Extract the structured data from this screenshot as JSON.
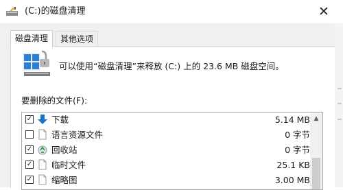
{
  "window": {
    "title": "(C:)的磁盘清理",
    "close_glyph": "✕",
    "title_icon": "disk-cleanup-icon"
  },
  "tabs": [
    {
      "label": "磁盘清理",
      "active": true
    },
    {
      "label": "其他选项",
      "active": false
    }
  ],
  "info": {
    "icon": "disk-cleanup-large-icon",
    "text": "可以使用“磁盘清理”来释放  (C:) 上的 23.6 MB 磁盘空间。"
  },
  "files_section": {
    "label": "要删除的文件(F):",
    "items": [
      {
        "name": "下载",
        "size": "5.14 MB",
        "checked": true,
        "icon": "download-arrow-icon"
      },
      {
        "name": "语言资源文件",
        "size": "0 字节",
        "checked": false,
        "icon": "file-icon"
      },
      {
        "name": "回收站",
        "size": "0 字节",
        "checked": true,
        "icon": "recycle-bin-icon"
      },
      {
        "name": "临时文件",
        "size": "25.1 KB",
        "checked": true,
        "icon": "file-icon"
      },
      {
        "name": "缩略图",
        "size": "3.00 MB",
        "checked": true,
        "icon": "file-icon"
      }
    ],
    "check_glyph": "✓",
    "scroll_up_glyph": "▲"
  },
  "colors": {
    "accent": "#1a73c9",
    "panel": "#f0f0f0",
    "border": "#a8a8a8"
  }
}
